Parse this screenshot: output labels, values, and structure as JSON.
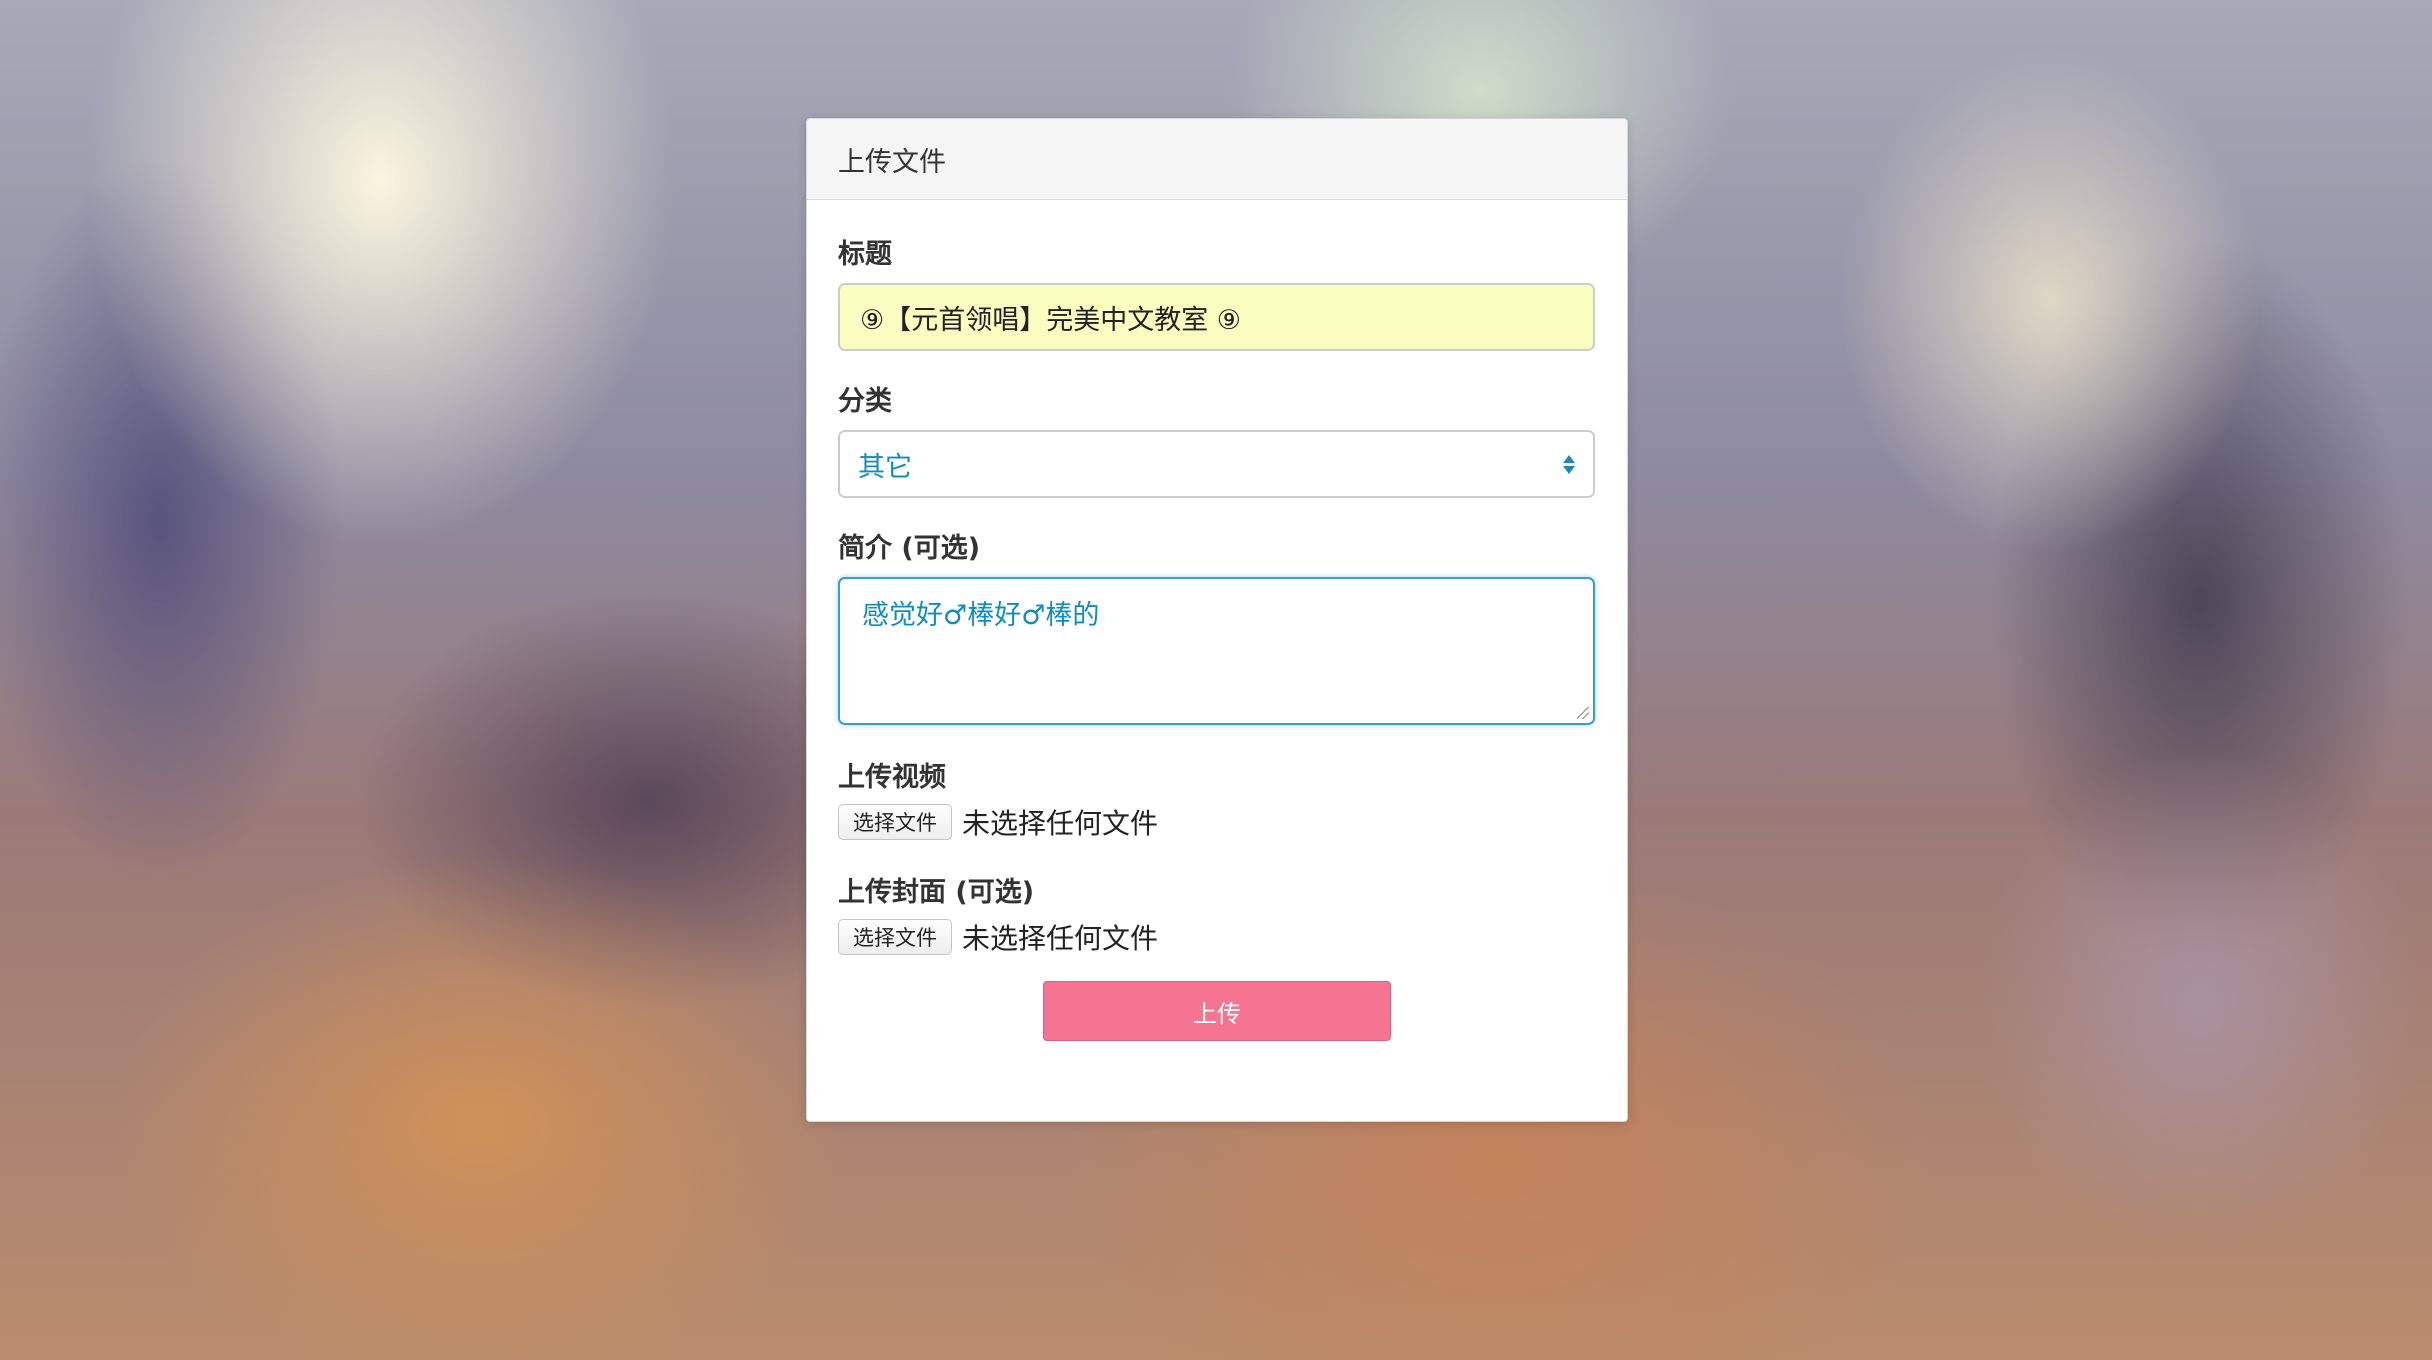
{
  "card": {
    "title": "上传文件"
  },
  "form": {
    "title_label": "标题",
    "title_value": "⑨【元首领唱】完美中文教室 ⑨",
    "category_label": "分类",
    "category_selected": "其它",
    "intro_label": "简介 (可选)",
    "intro_value": "感觉好♂棒好♂棒的",
    "video_label": "上传视频",
    "video_button": "选择文件",
    "video_status": "未选择任何文件",
    "cover_label": "上传封面 (可选)",
    "cover_button": "选择文件",
    "cover_status": "未选择任何文件",
    "submit_label": "上传"
  },
  "colors": {
    "submit": "#f47492",
    "accent_text": "#0e8cc2",
    "focus_border": "#3a9bd9",
    "autofill_bg": "#f9fdbf"
  }
}
